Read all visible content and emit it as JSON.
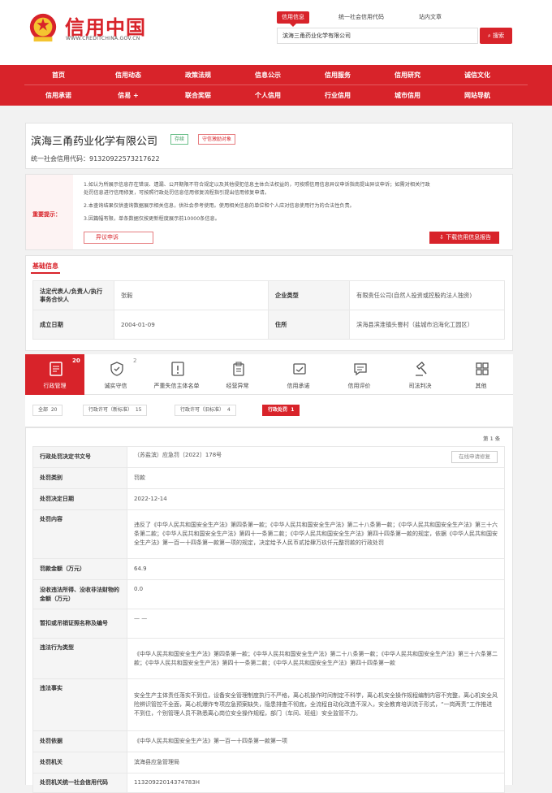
{
  "header": {
    "logo_title": "信用中国",
    "logo_url": "WWW.CREDITCHINA.GOV.CN",
    "search_tabs": [
      "信用信息",
      "统一社会信用代码",
      "站内文章"
    ],
    "search_value": "滨海三甬药业化学有限公司",
    "search_button": "搜索"
  },
  "nav": {
    "row1": [
      "首页",
      "信用动态",
      "政策法规",
      "信息公示",
      "信用服务",
      "信用研究",
      "诚信文化"
    ],
    "row2": [
      "信用承诺",
      "信易 +",
      "联合奖惩",
      "个人信用",
      "行业信用",
      "城市信用",
      "网站导航"
    ]
  },
  "company": {
    "name": "滨海三甬药业化学有限公司",
    "status_badge": "存续",
    "warn_badge": "守信激励对象",
    "credit_code_label": "统一社会信用代码：",
    "credit_code": "91320922573217622"
  },
  "notice": {
    "label": "重要提示：",
    "lines": [
      "1.如认为所展示信息存在错误、遗漏、公开期限不符合规定以及其他侵犯信息主体合法权益的，可按照信用信息异议申诉指南提出异议申诉；如需对相关行政",
      "处罚信息进行信用修复，可按照行政处罚信息信用修复流程指引提出信用修复申请。",
      "2.本查询结果仅供查询数据展示相关信息，供社会参考使用。使用相关信息的单位和个人应对信息使用行为的合法性负责。",
      "3.因篇幅有限，单条数据仅按更新程度展示前10000条信息。"
    ],
    "objection_button": "异议申诉",
    "download_button": "下载信用信息报告"
  },
  "basic": {
    "title": "基础信息",
    "rows": [
      {
        "k1": "法定代表人/负责人/执行事务合伙人",
        "v1": "张毅",
        "k2": "企业类型",
        "v2": "有限责任公司(自然人投资或控股的法人独资)"
      },
      {
        "k1": "成立日期",
        "v1": "2004-01-09",
        "k2": "住所",
        "v2": "滨海县滨淮镇头罾村（盐城市沿海化工园区）"
      }
    ]
  },
  "tabs": [
    {
      "label": "行政管理",
      "count": "20",
      "icon": "document-icon"
    },
    {
      "label": "诚实守信",
      "count": "2",
      "icon": "shield-icon"
    },
    {
      "label": "严重失信主体名单",
      "count": "",
      "icon": "warning-list-icon"
    },
    {
      "label": "经营异常",
      "count": "",
      "icon": "clipboard-icon"
    },
    {
      "label": "信用承诺",
      "count": "",
      "icon": "handshake-icon"
    },
    {
      "label": "信用评价",
      "count": "",
      "icon": "chat-icon"
    },
    {
      "label": "司法判决",
      "count": "",
      "icon": "gavel-icon"
    },
    {
      "label": "其他",
      "count": "",
      "icon": "grid-icon"
    }
  ],
  "subtabs": [
    {
      "label": "全部",
      "count": "20"
    },
    {
      "label": "行政许可（新标准）",
      "count": "15"
    },
    {
      "label": "行政许可（旧标准）",
      "count": "4"
    },
    {
      "label": "行政处罚",
      "count": "1"
    }
  ],
  "pager": "第 1 条",
  "detail": {
    "repair_button": "在线申请修复",
    "rows": [
      {
        "k": "行政处罚决定书文号",
        "v": "（苏盐滨）应急罚〔2022〕178号"
      },
      {
        "k": "处罚类别",
        "v": "罚款"
      },
      {
        "k": "处罚决定日期",
        "v": "2022-12-14"
      },
      {
        "k": "处罚内容",
        "v": "违反了《中华人民共和国安全生产法》第四条第一款；《中华人民共和国安全生产法》第二十八条第一款；《中华人民共和国安全生产法》第三十六条第二款；《中华人民共和国安全生产法》第四十一条第二款；《中华人民共和国安全生产法》第四十四条第一款的规定，依据《中华人民共和国安全生产法》第一百一十四条第一款第一项的规定，决定给予人民币贰拾肆万玖仟元整罚款的行政处罚"
      },
      {
        "k": "罚款金额（万元）",
        "v": "64.9"
      },
      {
        "k": "没收违法所得、没收非法财物的金额（万元）",
        "v": "0.0"
      },
      {
        "k": "暂扣或吊销证照名称及编号",
        "v": "— —"
      },
      {
        "k": "违法行为类型",
        "v": "《中华人民共和国安全生产法》第四条第一款；《中华人民共和国安全生产法》第二十八条第一款；《中华人民共和国安全生产法》第三十六条第二款；《中华人民共和国安全生产法》第四十一条第二款；《中华人民共和国安全生产法》第四十四条第一款"
      },
      {
        "k": "违法事实",
        "v": "安全生产主体责任落实不到位，设备安全管理制度执行不严格，离心机操作时间制定不科学，离心机安全操作规程编制内容不完整，离心机安全风险辨识管控不全面，离心机爆炸专项应急预案缺失，隐患排查不彻底，全流程自动化改造不深入，安全教育培训流于形式，“一岗两责”工作推进不到位，个别管理人员不熟悉离心岗位安全操作规程，部门（车间、班组）安全监管不力。"
      },
      {
        "k": "处罚依据",
        "v": "《中华人民共和国安全生产法》第一百一十四条第一款第一项"
      },
      {
        "k": "处罚机关",
        "v": "滨海县应急管理局"
      },
      {
        "k": "处罚机关统一社会信用代码",
        "v": "11320922014374783H"
      }
    ]
  },
  "colors": {
    "brand": "#d8232a",
    "green": "#3a9b5c"
  }
}
